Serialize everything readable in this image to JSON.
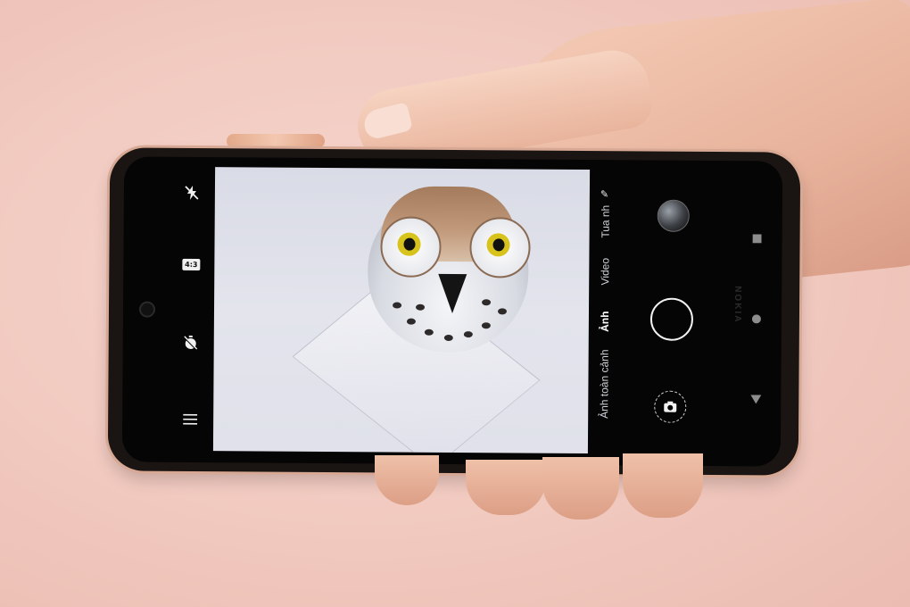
{
  "camera_app": {
    "left_toolbar": {
      "flash_icon": "flash-off-icon",
      "aspect_ratio": "4:3",
      "timer_icon": "timer-off-icon",
      "menu_icon": "menu-icon"
    },
    "modes": [
      {
        "label": "Ảnh toàn cảnh",
        "active": false
      },
      {
        "label": "Ảnh",
        "active": true
      },
      {
        "label": "Video",
        "active": false
      },
      {
        "label": "Tua nh",
        "active": false
      }
    ],
    "controls": {
      "gallery_icon": "gallery-thumbnail",
      "shutter_icon": "shutter-icon",
      "switch_camera_icon": "switch-camera-icon"
    },
    "navigation": {
      "recent_icon": "square-icon",
      "home_icon": "circle-icon",
      "back_icon": "triangle-icon"
    },
    "brand": "NOKIA"
  },
  "colors": {
    "background": "#f1c9bf",
    "phone_body": "#1a1412",
    "screen": "#050505"
  }
}
